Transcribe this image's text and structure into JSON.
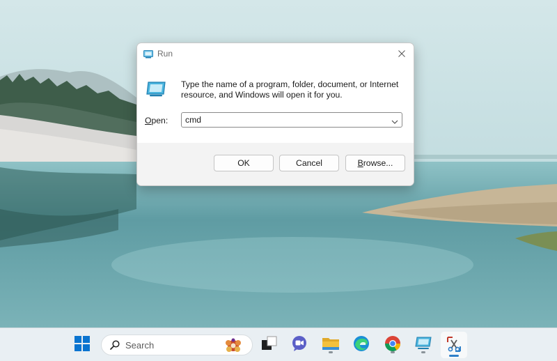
{
  "dialog": {
    "title": "Run",
    "description": "Type the name of a program, folder, document, or Internet resource, and Windows will open it for you.",
    "open_label_accel": "O",
    "open_label_rest": "pen:",
    "command_value": "cmd",
    "ok_label": "OK",
    "cancel_label": "Cancel",
    "browse_label_accel": "B",
    "browse_label_rest": "rowse..."
  },
  "taskbar": {
    "search_label": "Search",
    "icons": [
      "windows-start-icon",
      "search-icon",
      "task-view-icon",
      "chat-icon",
      "file-explorer-icon",
      "edge-icon",
      "chrome-icon",
      "run-icon",
      "snipping-tool-icon"
    ]
  },
  "colors": {
    "accent": "#2f7fc8",
    "start_blue": "#0078d4",
    "folder_yellow": "#f4c13d",
    "chat_purple": "#5b5fc7"
  }
}
